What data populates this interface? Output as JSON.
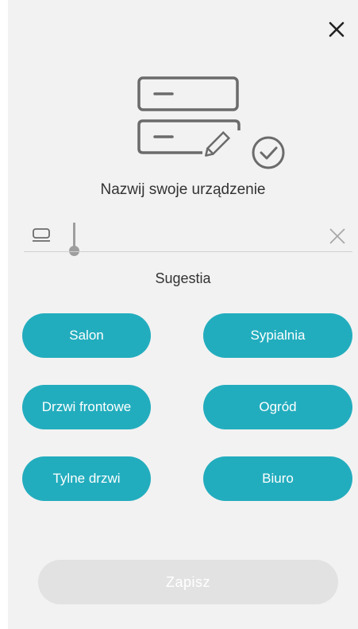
{
  "dialog": {
    "title": "Nazwij swoje urządzenie",
    "close_icon": "close-icon"
  },
  "name_input": {
    "value": "",
    "placeholder": "",
    "leading_icon": "device-icon",
    "clear_icon": "clear-icon"
  },
  "suggestions": {
    "label": "Sugestia",
    "items": [
      {
        "label": "Salon"
      },
      {
        "label": "Sypialnia"
      },
      {
        "label": "Drzwi frontowe"
      },
      {
        "label": "Ogród"
      },
      {
        "label": "Tylne drzwi"
      },
      {
        "label": "Biuro"
      }
    ]
  },
  "save_button": {
    "label": "Zapisz",
    "enabled": false
  },
  "colors": {
    "accent": "#22adbe",
    "background": "#f2f2f2",
    "disabled": "#e2e2e2",
    "icon_gray": "#6b6b6b"
  }
}
